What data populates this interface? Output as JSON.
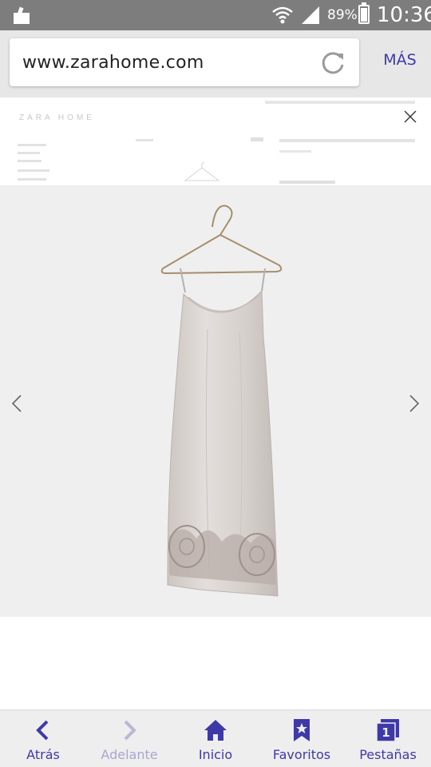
{
  "status_bar": {
    "battery_percent": "89%",
    "battery_level": 0.89,
    "time": "10:36"
  },
  "browser": {
    "url": "www.zarahome.com",
    "menu_label": "MÁS",
    "accent_color": "#3f39a8"
  },
  "site": {
    "logo": "ZARA HOME"
  },
  "product_viewer": {
    "background_color": "#efefef",
    "prev_icon": "chevron-left-icon",
    "next_icon": "chevron-right-icon",
    "close_icon": "close-icon"
  },
  "bottom_nav": {
    "items": [
      {
        "label": "Atrás",
        "icon": "back-icon",
        "enabled": true
      },
      {
        "label": "Adelante",
        "icon": "forward-icon",
        "enabled": false
      },
      {
        "label": "Inicio",
        "icon": "home-icon",
        "enabled": true
      },
      {
        "label": "Favoritos",
        "icon": "bookmark-icon",
        "enabled": true
      },
      {
        "label": "Pestañas",
        "icon": "tabs-icon",
        "enabled": true,
        "badge": "1"
      }
    ]
  }
}
